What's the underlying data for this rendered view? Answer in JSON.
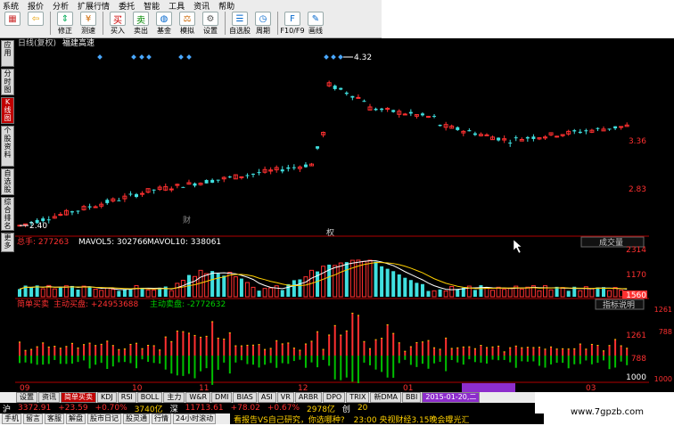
{
  "menu": [
    "系统",
    "报价",
    "分析",
    "扩展行情",
    "委托",
    "智能",
    "工具",
    "资讯",
    "帮助"
  ],
  "toolbar": [
    {
      "label": "",
      "icon": "grid-icon"
    },
    {
      "label": "",
      "icon": "back-arrow-icon"
    },
    {
      "label": "修正",
      "icon": "arrows-updown-icon"
    },
    {
      "label": "测速",
      "icon": "yuan-icon"
    },
    {
      "label": "买入",
      "icon": "buy-icon",
      "glyph": "买"
    },
    {
      "label": "卖出",
      "icon": "sell-icon",
      "glyph": "卖"
    },
    {
      "label": "基金",
      "icon": "fund-icon"
    },
    {
      "label": "模拟",
      "icon": "simulate-icon"
    },
    {
      "label": "设置",
      "icon": "settings-icon"
    },
    {
      "label": "自选股",
      "icon": "star-list-icon"
    },
    {
      "label": "周期",
      "icon": "period-icon"
    },
    {
      "label": "F10/F9",
      "icon": "f10-icon"
    },
    {
      "label": "画线",
      "icon": "draw-line-icon"
    }
  ],
  "left_tabs": [
    "应用",
    "分时图",
    "K线图",
    "个股资料",
    "自选股",
    "综合排名",
    "更多"
  ],
  "chart": {
    "title_tag": "日线(复权)",
    "stock_name": "福建高速",
    "price_high_label": "4.32",
    "price_low_label": "2.40",
    "axis_prices": [
      "3.36",
      "2.83"
    ],
    "vol_label": "总手: 277263",
    "mavol5": "MAVOL5: 302766",
    "mavol10": "MAVOL10: 338061",
    "vol_dropdown": "成交量",
    "vol_axis": [
      "2314",
      "1170",
      "1560"
    ],
    "ind_label": "简单买卖",
    "ind_buy": "主动买盘: +24953688",
    "ind_sell": "主动卖盘: -2772632",
    "ind_button": "指标说明",
    "ind_axis": [
      "1261",
      "788",
      "1000"
    ],
    "x_labels": [
      "09",
      "10",
      "11",
      "12",
      "01",
      "03"
    ],
    "marks": [
      "财",
      "权"
    ]
  },
  "bottom_tabs": [
    "设置",
    "资讯",
    "简单买卖",
    "KDJ",
    "RSI",
    "BOLL",
    "主力",
    "W&R",
    "DMI",
    "BIAS",
    "ASI",
    "VR",
    "ARBR",
    "DPO",
    "TRIX",
    "新DMA",
    "BBI"
  ],
  "date_tag": "2015-01-20,二",
  "ticker": {
    "sh": "沪",
    "sh_index": "3372.91",
    "sh_change": "+23.59",
    "sh_pct": "+0.70%",
    "sh_amount": "3740亿",
    "sz": "深",
    "sz_index": "11713.61",
    "sz_change": "+78.02",
    "sz_pct": "+0.67%",
    "sz_amount": "2978亿",
    "cy": "创",
    "cy_tail": "20"
  },
  "footer": [
    "手机",
    "留言",
    "客服",
    "解盘",
    "股市日记",
    "股灵通",
    "行情",
    "24小时滚动"
  ],
  "news": [
    "看报告VS自己研究，你选哪种?",
    "23:00 央视财经3.15晚会曝光汇"
  ],
  "watermark": "www.7gpzb.com"
}
